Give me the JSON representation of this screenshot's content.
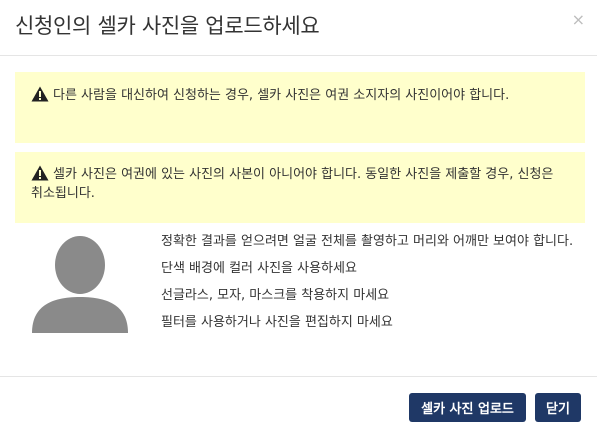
{
  "dialog": {
    "title": "신청인의 셀카 사진을 업로드하세요",
    "close_symbol": "×"
  },
  "alerts": [
    {
      "icon": "warning-icon",
      "text": "다른 사람을 대신하여 신청하는 경우, 셀카 사진은 여권 소지자의 사진이어야 합니다."
    },
    {
      "icon": "warning-icon",
      "text": "셀카 사진은 여권에 있는 사진의 사본이 아니어야 합니다. 동일한 사진을 제출할 경우, 신청은 취소됩니다."
    }
  ],
  "tips": [
    "정확한 결과를 얻으려면 얼굴 전체를 촬영하고 머리와 어깨만 보여야 합니다.",
    "단색 배경에 컬러 사진을 사용하세요",
    "선글라스, 모자, 마스크를 착용하지 마세요",
    "필터를 사용하거나 사진을 편집하지 마세요"
  ],
  "buttons": {
    "upload_label": "셀카 사진 업로드",
    "close_label": "닫기"
  },
  "colors": {
    "alert_background": "#ffffcc",
    "button_background": "#1f3866",
    "avatar_gray": "#8a8a8a"
  }
}
